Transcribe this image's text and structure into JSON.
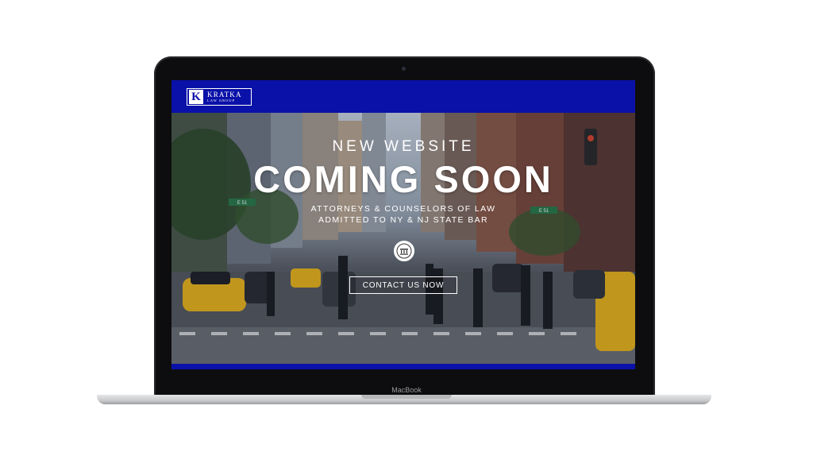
{
  "device": {
    "brand_label": "MacBook"
  },
  "site": {
    "logo": {
      "mark": "K",
      "name": "KRATKA",
      "tagline": "LAW GROUP"
    },
    "hero": {
      "kicker": "NEW WEBSITE",
      "title": "COMING SOON",
      "line1": "ATTORNEYS & COUNSELORS OF LAW",
      "line2": "ADMITTED TO NY & NJ STATE BAR",
      "cta_label": "CONTACT US NOW"
    },
    "street_signs": [
      "E 51",
      "E 51"
    ]
  },
  "colors": {
    "brand_blue": "#0a11a8",
    "taxi_yellow": "#e8b41c"
  },
  "icons": [
    "court-seal-icon"
  ]
}
